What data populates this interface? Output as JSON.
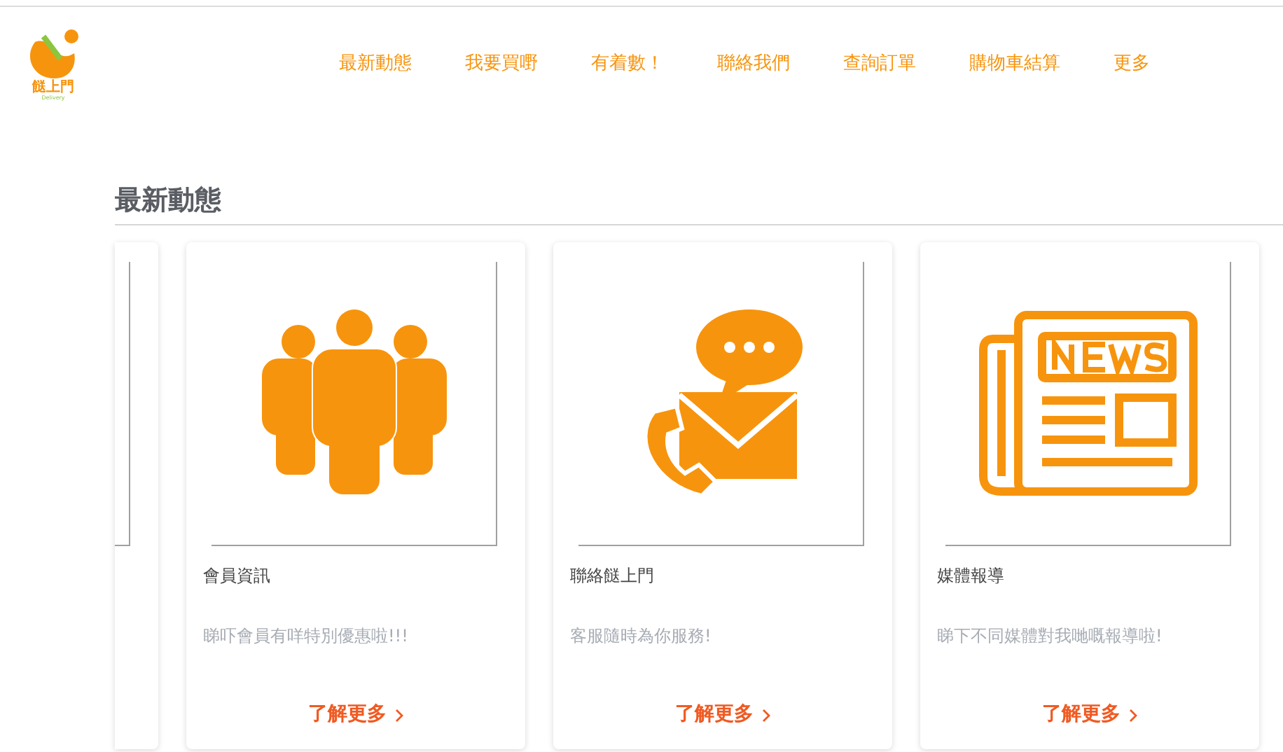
{
  "logo": {
    "name": "餸上門",
    "tagline": "Delivery"
  },
  "nav": [
    "最新動態",
    "我要買嘢",
    "有着數！",
    "聯絡我們",
    "查詢訂單",
    "購物車結算",
    "更多"
  ],
  "section_title": "最新動態",
  "cards": [
    {
      "kind": "cut"
    },
    {
      "kind": "members",
      "title": "會員資訊",
      "description": "睇吓會員有咩特別優惠啦!!!",
      "link": "了解更多"
    },
    {
      "kind": "contact",
      "title": "聯絡餸上門",
      "description": "客服隨時為你服務!",
      "link": "了解更多"
    },
    {
      "kind": "news",
      "title": "媒體報導",
      "description": "睇下不同媒體對我哋嘅報導啦!",
      "link": "了解更多"
    }
  ]
}
